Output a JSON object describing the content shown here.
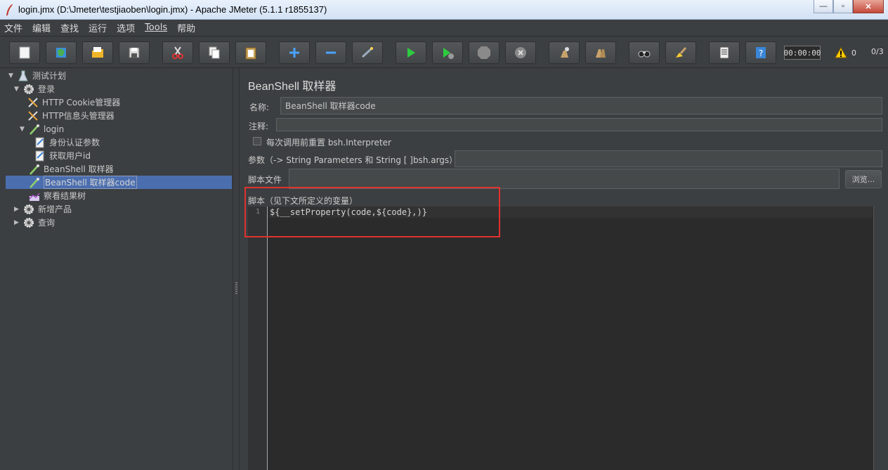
{
  "window": {
    "title": "login.jmx (D:\\Jmeter\\testjiaoben\\login.jmx) - Apache JMeter (5.1.1 r1855137)",
    "minimize": "—",
    "maximize": "▫",
    "close": "✕"
  },
  "menu": [
    "文件",
    "编辑",
    "查找",
    "运行",
    "选项",
    "Tools",
    "帮助"
  ],
  "toolbar": {
    "timer": "00:00:00",
    "warnings": "0",
    "threads": "0/3"
  },
  "tree": {
    "items": [
      {
        "label": "测试计划",
        "selected": false
      },
      {
        "label": "登录",
        "selected": false
      },
      {
        "label": "HTTP Cookie管理器",
        "selected": false
      },
      {
        "label": "HTTP信息头管理器",
        "selected": false
      },
      {
        "label": "login",
        "selected": false
      },
      {
        "label": "身份认证参数",
        "selected": false
      },
      {
        "label": "获取用户id",
        "selected": false
      },
      {
        "label": "BeanShell 取样器",
        "selected": false
      },
      {
        "label": "BeanShell 取样器code",
        "selected": true
      },
      {
        "label": "察看结果树",
        "selected": false
      },
      {
        "label": "新增产品",
        "selected": false
      },
      {
        "label": "查询",
        "selected": false
      }
    ]
  },
  "panel": {
    "title": "BeanShell 取样器",
    "name_label": "名称:",
    "name_value": "BeanShell 取样器code",
    "comment_label": "注释:",
    "comment_value": "",
    "reset_label": "每次调用前重置 bsh.Interpreter",
    "params_label": "参数（-> String Parameters 和 String [ ]bsh.args）",
    "params_value": "",
    "script_file_label": "脚本文件",
    "script_file_value": "",
    "browse_label": "浏览...",
    "script_label": "脚本（见下文所定义的变量）",
    "line_number": "1",
    "script_code": "${__setProperty(code,${code},)}"
  },
  "colors": {
    "background": "#3c3f41",
    "selection": "#4b6eaf",
    "editor": "#2b2b2b",
    "highlight_box": "#e0322e"
  }
}
